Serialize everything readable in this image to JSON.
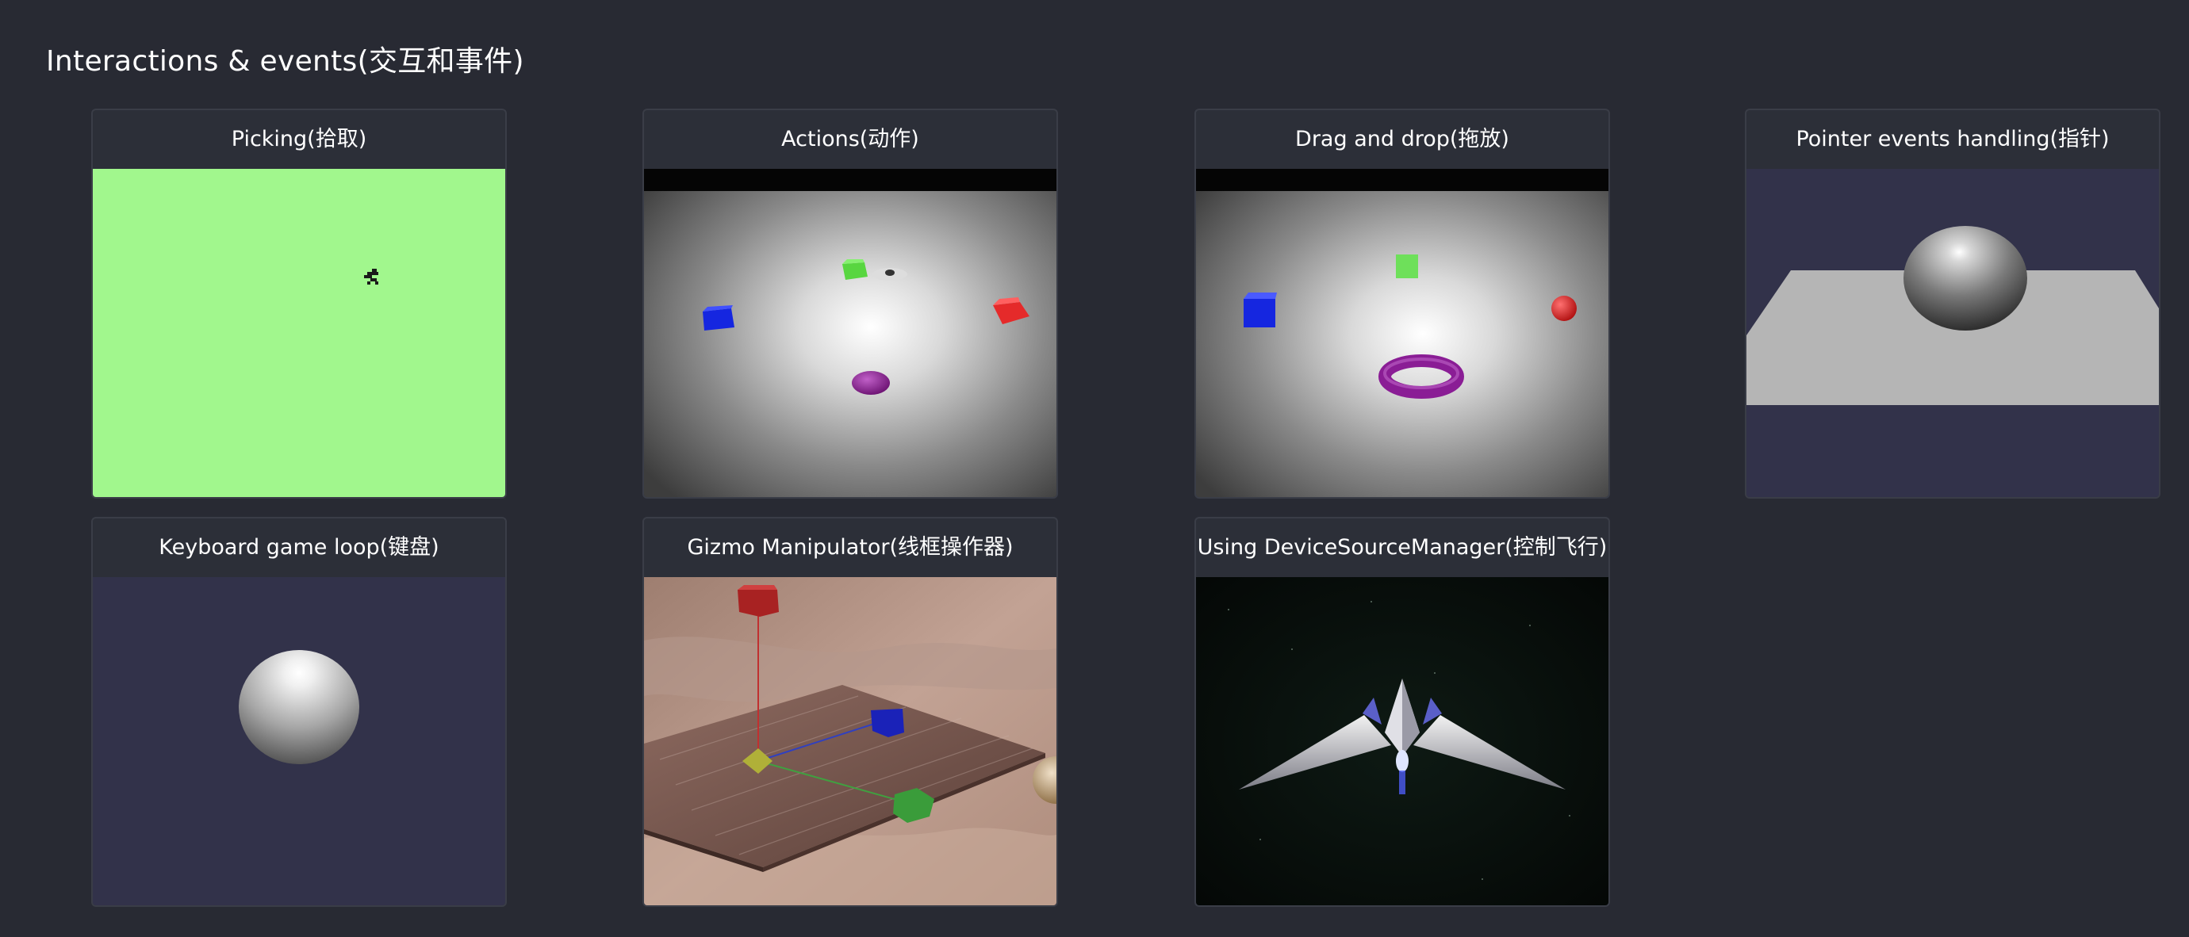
{
  "section": {
    "title": "Interactions & events(交互和事件)"
  },
  "cards": [
    {
      "title": "Picking(拾取)",
      "thumbnail": "picking-scene"
    },
    {
      "title": "Actions(动作)",
      "thumbnail": "actions-scene"
    },
    {
      "title": "Drag and drop(拖放)",
      "thumbnail": "drag-drop-scene"
    },
    {
      "title": "Pointer events handling(指针)",
      "thumbnail": "pointer-events-scene"
    },
    {
      "title": "Keyboard game loop(键盘)",
      "thumbnail": "keyboard-scene"
    },
    {
      "title": "Gizmo Manipulator(线框操作器)",
      "thumbnail": "gizmo-scene"
    },
    {
      "title": "Using DeviceSourceManager(控制飞行)",
      "thumbnail": "spaceship-scene"
    }
  ],
  "colors": {
    "page_background": "#282a33",
    "card_background": "#2c2f38",
    "card_border": "#3a3d47",
    "title_text": "#ffffff",
    "picking_green": "#a1f78d"
  }
}
